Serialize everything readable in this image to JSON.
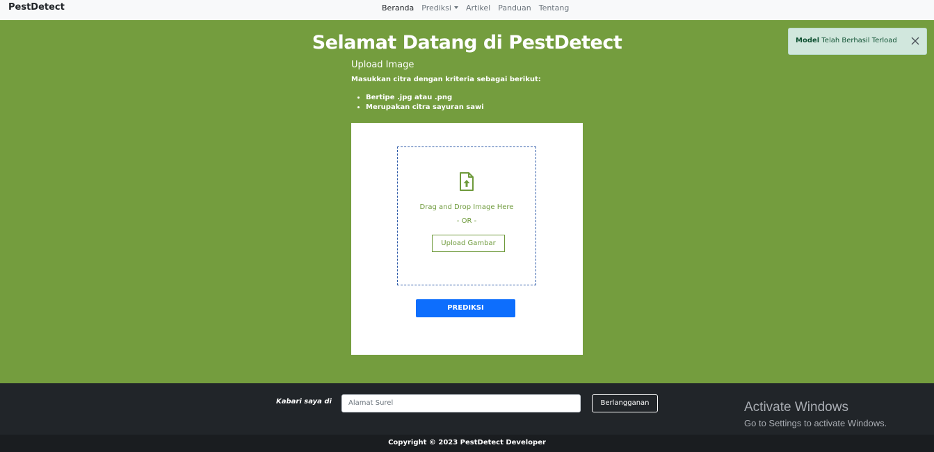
{
  "navbar": {
    "brand": "PestDetect",
    "items": [
      {
        "label": "Beranda"
      },
      {
        "label": "Prediksi"
      },
      {
        "label": "Artikel"
      },
      {
        "label": "Panduan"
      },
      {
        "label": "Tentang"
      }
    ]
  },
  "main": {
    "title": "Selamat Datang di PestDetect",
    "subtitle": "Upload Image",
    "criteria_intro": "Masukkan citra dengan kriteria sebagai berikut:",
    "criteria": [
      "Bertipe .jpg atau .png",
      "Merupakan citra sayuran sawi"
    ],
    "dropzone": {
      "icon": "file-upload-icon",
      "text": "Drag and Drop Image Here",
      "or_text": "- OR -",
      "upload_label": "Upload Gambar"
    },
    "predict_label": "PREDIKSI"
  },
  "toast": {
    "bold": "Model",
    "text": " Telah Berhasil Terload",
    "close_icon": "close-icon"
  },
  "footer": {
    "subscribe_label": "Kabari saya di",
    "email_placeholder": "Alamat Surel",
    "subscribe_button": "Berlangganan",
    "copyright": "Copyright © 2023 PestDetect Developer"
  },
  "watermark": {
    "line1": "Activate Windows",
    "line2": "Go to Settings to activate Windows."
  },
  "colors": {
    "background": "#749d3e",
    "accent_green": "#6e9a3b",
    "primary_blue": "#0d6efd",
    "footer_dark": "#212529"
  }
}
